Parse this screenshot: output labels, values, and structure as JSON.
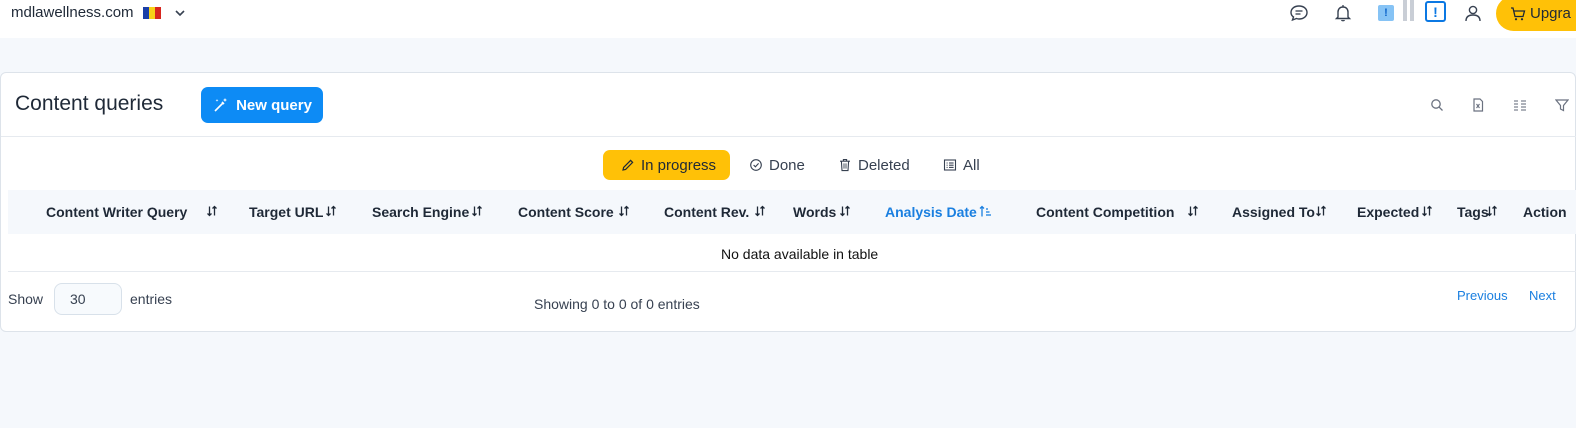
{
  "header": {
    "site": "mdlawellness.com",
    "upgrade_label": "Upgra",
    "alert_badge": "!",
    "alert_outline": "!",
    "flag_colors": [
      "#1a3fa8",
      "#f7d117",
      "#d7261e"
    ],
    "icons": [
      "chat-icon",
      "bell-icon",
      "user-icon",
      "cart-icon",
      "chevron-down-icon"
    ]
  },
  "page": {
    "title": "Content queries",
    "new_query_label": "New query",
    "tools": [
      "search-icon",
      "export-icon",
      "columns-icon",
      "filter-icon"
    ]
  },
  "tabs": [
    {
      "label": "In progress",
      "icon": "pencil-icon",
      "active": true
    },
    {
      "label": "Done",
      "icon": "check-circle-icon",
      "active": false
    },
    {
      "label": "Deleted",
      "icon": "trash-icon",
      "active": false
    },
    {
      "label": "All",
      "icon": "list-icon",
      "active": false
    }
  ],
  "table": {
    "columns": [
      {
        "label": "Content Writer Query"
      },
      {
        "label": "Target URL"
      },
      {
        "label": "Search Engine"
      },
      {
        "label": "Content Score"
      },
      {
        "label": "Content Rev."
      },
      {
        "label": "Words"
      },
      {
        "label": "Analysis Date",
        "sorted": "ascending"
      },
      {
        "label": "Content Competition"
      },
      {
        "label": "Assigned To"
      },
      {
        "label": "Expected"
      },
      {
        "label": "Tags"
      },
      {
        "label": "Action"
      }
    ],
    "empty_text": "No data available in table"
  },
  "footer": {
    "show_label": "Show",
    "entries_value": "30",
    "entries_label": "entries",
    "info": "Showing 0 to 0 of 0 entries",
    "previous": "Previous",
    "next": "Next"
  },
  "colors": {
    "accent_blue": "#0d8bf5",
    "accent_yellow": "#ffc107",
    "link_blue": "#1a7fe0"
  }
}
